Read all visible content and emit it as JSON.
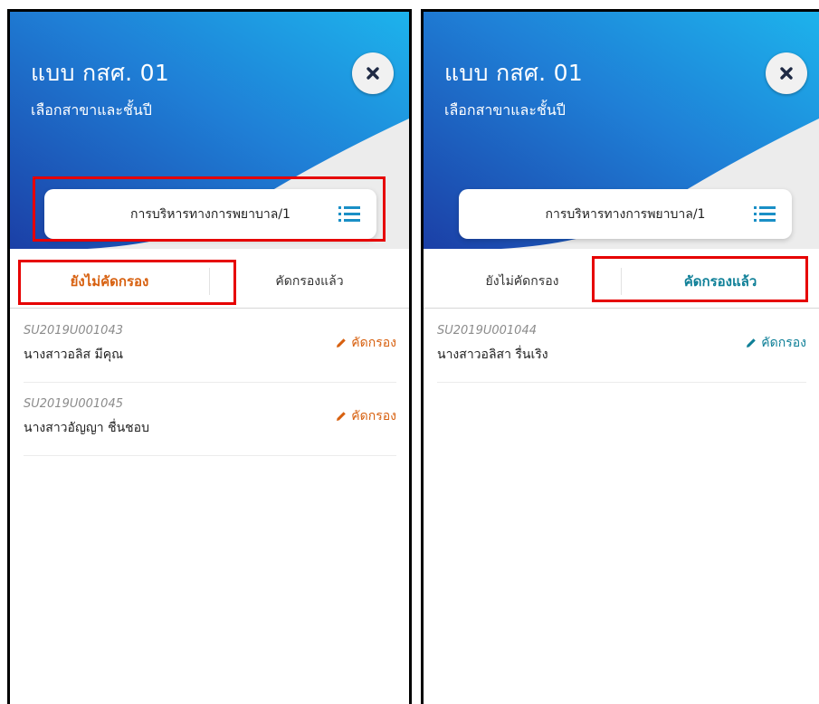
{
  "colors": {
    "header_dark": "#1b3fa6",
    "header_light": "#1db3ec",
    "accent_orange": "#d7600f",
    "accent_teal": "#0e7f97",
    "highlight_red": "#e60000"
  },
  "panels": [
    {
      "title": "แบบ กสศ. 01",
      "subtitle": "เลือกสาขาและชั้นปี",
      "close_icon": "close-icon",
      "selected_program": "การบริหารทางการพยาบาล/1",
      "list_icon": "list-icon",
      "tabs": [
        {
          "label": "ยังไม่คัดกรอง",
          "active": true
        },
        {
          "label": "คัดกรองแล้ว",
          "active": false
        }
      ],
      "items": [
        {
          "code": "SU2019U001043",
          "name": "นางสาวอลิส มีคุณ",
          "action": "คัดกรอง"
        },
        {
          "code": "SU2019U001045",
          "name": "นางสาวอัญญา ชื่นชอบ",
          "action": "คัดกรอง"
        }
      ]
    },
    {
      "title": "แบบ กสศ. 01",
      "subtitle": "เลือกสาขาและชั้นปี",
      "close_icon": "close-icon",
      "selected_program": "การบริหารทางการพยาบาล/1",
      "list_icon": "list-icon",
      "tabs": [
        {
          "label": "ยังไม่คัดกรอง",
          "active": false
        },
        {
          "label": "คัดกรองแล้ว",
          "active": true
        }
      ],
      "items": [
        {
          "code": "SU2019U001044",
          "name": "นางสาวอลิสา รื่นเริง",
          "action": "คัดกรอง"
        }
      ]
    }
  ]
}
